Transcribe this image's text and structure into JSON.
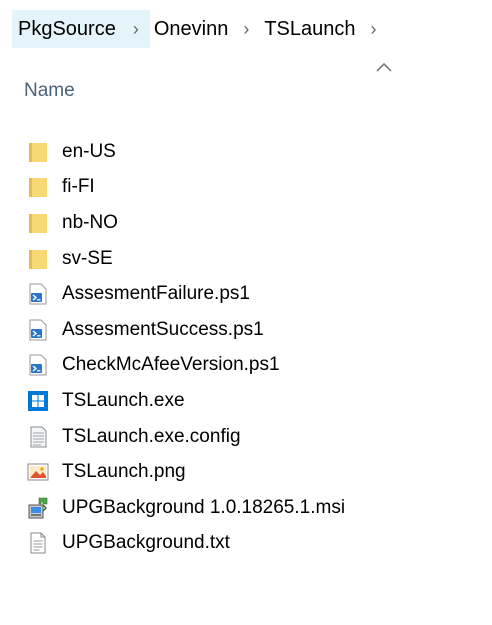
{
  "breadcrumb": {
    "items": [
      {
        "label": "PkgSource"
      },
      {
        "label": "Onevinn"
      },
      {
        "label": "TSLaunch"
      }
    ]
  },
  "column_header": {
    "name_label": "Name",
    "sort_icon": "chevron-up-icon"
  },
  "files": [
    {
      "name": "en-US",
      "icon": "folder-icon"
    },
    {
      "name": "fi-FI",
      "icon": "folder-icon"
    },
    {
      "name": "nb-NO",
      "icon": "folder-icon"
    },
    {
      "name": "sv-SE",
      "icon": "folder-icon"
    },
    {
      "name": "AssesmentFailure.ps1",
      "icon": "powershell-script-icon"
    },
    {
      "name": "AssesmentSuccess.ps1",
      "icon": "powershell-script-icon"
    },
    {
      "name": "CheckMcAfeeVersion.ps1",
      "icon": "powershell-script-icon"
    },
    {
      "name": "TSLaunch.exe",
      "icon": "windows-exe-icon"
    },
    {
      "name": "TSLaunch.exe.config",
      "icon": "config-file-icon"
    },
    {
      "name": "TSLaunch.png",
      "icon": "image-file-icon"
    },
    {
      "name": "UPGBackground 1.0.18265.1.msi",
      "icon": "msi-installer-icon"
    },
    {
      "name": "UPGBackground.txt",
      "icon": "text-file-icon"
    }
  ],
  "colors": {
    "breadcrumb_highlight": "#e5f3fb",
    "folder": "#f8d775",
    "header_text": "#4c607a"
  }
}
